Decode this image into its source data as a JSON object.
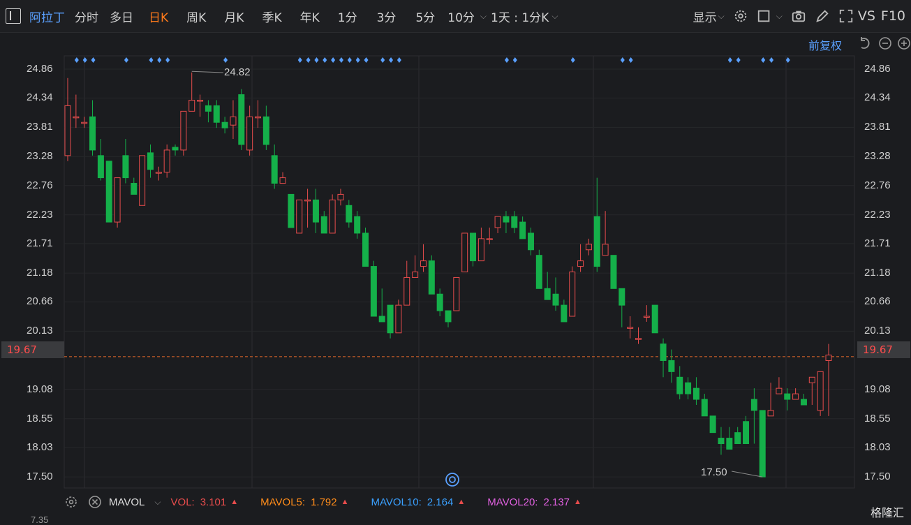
{
  "toolbar": {
    "stock_name": "阿拉丁",
    "periods": [
      "分时",
      "多日",
      "日K",
      "周K",
      "月K",
      "季K",
      "年K",
      "1分",
      "3分",
      "5分",
      "10分"
    ],
    "active_period": "日K",
    "interval_select": "1天 : 1分K",
    "display_label": "显示",
    "vs_label": "VS",
    "f10_label": "F10"
  },
  "chart": {
    "restore_label": "前复权",
    "price_ticks": [
      "24.86",
      "24.34",
      "23.81",
      "23.28",
      "22.76",
      "22.23",
      "21.71",
      "21.18",
      "20.66",
      "20.13",
      "19.08",
      "18.55",
      "18.03",
      "17.50"
    ],
    "current_price": "19.67",
    "high_label": "24.82",
    "low_label": "17.50",
    "bottom_partial": "7.35"
  },
  "indicators": {
    "name": "MAVOL",
    "vol_label": "VOL:",
    "vol_value": "3.101",
    "mavol5_label": "MAVOL5:",
    "mavol5_value": "1.792",
    "mavol10_label": "MAVOL10:",
    "mavol10_value": "2.164",
    "mavol20_label": "MAVOL20:",
    "mavol20_value": "2.137"
  },
  "colors": {
    "up": "#e74c4c",
    "down": "#15b04a",
    "accent": "#ff7a1a",
    "blue": "#5aa0ff",
    "mavol5": "#ff8c1a",
    "mavol10": "#3aa0ff",
    "mavol20": "#e060e0"
  },
  "watermark": "格隆汇",
  "chart_data": {
    "type": "candlestick",
    "ylim": [
      17.3,
      25.1
    ],
    "candles": [
      [
        23.3,
        24.2,
        24.7,
        23.2
      ],
      [
        24.0,
        24.0,
        24.4,
        23.8
      ],
      [
        23.9,
        23.9,
        24.0,
        23.8
      ],
      [
        24.0,
        23.4,
        24.3,
        23.3
      ],
      [
        23.3,
        22.9,
        23.6,
        22.85
      ],
      [
        23.2,
        22.1,
        23.2,
        22.1
      ],
      [
        22.1,
        22.9,
        22.9,
        22.0
      ],
      [
        23.3,
        22.9,
        23.6,
        22.8
      ],
      [
        22.8,
        22.6,
        22.9,
        22.6
      ],
      [
        22.4,
        23.3,
        23.3,
        22.4
      ],
      [
        23.35,
        23.05,
        23.5,
        22.9
      ],
      [
        23.0,
        23.0,
        23.1,
        22.85
      ],
      [
        23.0,
        23.4,
        23.5,
        22.9
      ],
      [
        23.45,
        23.4,
        23.5,
        23.3
      ],
      [
        23.4,
        24.1,
        24.1,
        23.3
      ],
      [
        24.1,
        24.3,
        24.8,
        24.1
      ],
      [
        24.3,
        24.3,
        24.4,
        24.0
      ],
      [
        24.2,
        24.1,
        24.3,
        23.9
      ],
      [
        24.2,
        23.9,
        24.3,
        23.8
      ],
      [
        23.9,
        23.8,
        24.0,
        23.7
      ],
      [
        23.85,
        24.0,
        24.3,
        23.6
      ],
      [
        24.4,
        23.5,
        24.5,
        23.4
      ],
      [
        23.4,
        24.0,
        24.2,
        23.3
      ],
      [
        24.0,
        24.0,
        24.3,
        23.8
      ],
      [
        24.0,
        23.5,
        24.2,
        23.4
      ],
      [
        23.3,
        22.8,
        23.5,
        22.7
      ],
      [
        22.8,
        22.9,
        23.0,
        22.8
      ],
      [
        22.6,
        22.0,
        22.6,
        22.0
      ],
      [
        21.9,
        22.5,
        22.5,
        21.9
      ],
      [
        22.5,
        22.5,
        22.7,
        22.0
      ],
      [
        22.5,
        22.1,
        22.7,
        21.9
      ],
      [
        22.2,
        21.9,
        22.3,
        21.9
      ],
      [
        21.9,
        22.5,
        22.6,
        21.9
      ],
      [
        22.5,
        22.6,
        22.7,
        22.4
      ],
      [
        22.4,
        22.1,
        22.5,
        22.0
      ],
      [
        22.2,
        21.9,
        22.3,
        21.8
      ],
      [
        21.9,
        21.3,
        22.0,
        21.3
      ],
      [
        21.3,
        20.4,
        21.4,
        20.4
      ],
      [
        20.4,
        20.3,
        20.9,
        20.3
      ],
      [
        20.6,
        20.1,
        20.6,
        20.0
      ],
      [
        20.1,
        20.6,
        20.7,
        20.1
      ],
      [
        20.6,
        21.1,
        21.4,
        20.6
      ],
      [
        21.1,
        21.2,
        21.5,
        21.1
      ],
      [
        21.3,
        21.4,
        21.7,
        21.2
      ],
      [
        21.4,
        20.8,
        21.5,
        20.8
      ],
      [
        20.8,
        20.5,
        20.9,
        20.4
      ],
      [
        20.5,
        20.3,
        20.5,
        20.2
      ],
      [
        20.5,
        21.1,
        21.1,
        20.5
      ],
      [
        21.2,
        21.9,
        21.9,
        21.2
      ],
      [
        21.9,
        21.4,
        21.9,
        21.3
      ],
      [
        21.4,
        21.8,
        22.0,
        21.4
      ],
      [
        21.8,
        21.8,
        22.0,
        21.7
      ],
      [
        22.0,
        22.2,
        22.2,
        21.9
      ],
      [
        22.2,
        22.1,
        22.3,
        21.9
      ],
      [
        22.2,
        22.0,
        22.3,
        21.9
      ],
      [
        22.1,
        21.8,
        22.2,
        21.8
      ],
      [
        21.9,
        21.6,
        22.0,
        21.5
      ],
      [
        21.5,
        20.9,
        21.6,
        20.9
      ],
      [
        20.9,
        20.7,
        21.2,
        20.7
      ],
      [
        20.8,
        20.6,
        21.1,
        20.5
      ],
      [
        20.6,
        20.3,
        20.7,
        20.3
      ],
      [
        20.4,
        21.2,
        21.3,
        20.4
      ],
      [
        21.3,
        21.4,
        21.7,
        21.2
      ],
      [
        21.6,
        21.7,
        21.8,
        21.5
      ],
      [
        22.2,
        21.3,
        22.9,
        21.2
      ],
      [
        21.5,
        21.7,
        22.3,
        21.5
      ],
      [
        21.5,
        20.9,
        21.5,
        20.9
      ],
      [
        20.9,
        20.6,
        20.9,
        20.2
      ],
      [
        20.2,
        20.2,
        20.4,
        20.0
      ],
      [
        20.0,
        20.0,
        20.2,
        19.9
      ],
      [
        20.4,
        20.4,
        20.6,
        20.3
      ],
      [
        20.6,
        20.1,
        20.6,
        20.1
      ],
      [
        19.9,
        19.6,
        20.0,
        19.3
      ],
      [
        19.6,
        19.4,
        19.8,
        19.2
      ],
      [
        19.3,
        19.0,
        19.5,
        18.9
      ],
      [
        19.2,
        19.0,
        19.3,
        18.9
      ],
      [
        19.1,
        18.9,
        19.3,
        18.8
      ],
      [
        18.9,
        18.6,
        19.0,
        18.6
      ],
      [
        18.6,
        18.3,
        18.6,
        18.3
      ],
      [
        18.2,
        18.1,
        18.4,
        17.9
      ],
      [
        18.2,
        18.0,
        18.4,
        18.0
      ],
      [
        18.3,
        18.1,
        18.4,
        18.1
      ],
      [
        18.5,
        18.1,
        18.6,
        18.1
      ],
      [
        18.9,
        18.7,
        19.1,
        18.1
      ],
      [
        18.7,
        17.5,
        18.7,
        17.5
      ],
      [
        18.6,
        18.7,
        19.2,
        18.6
      ],
      [
        19.0,
        19.1,
        19.3,
        19.0
      ],
      [
        19.0,
        18.9,
        19.1,
        18.7
      ],
      [
        18.9,
        19.0,
        19.1,
        18.9
      ],
      [
        18.9,
        18.8,
        19.0,
        18.8
      ],
      [
        19.2,
        19.3,
        19.3,
        18.8
      ],
      [
        18.7,
        19.4,
        19.4,
        18.6
      ],
      [
        19.6,
        19.7,
        19.9,
        18.6
      ]
    ],
    "dot_markers_columns": [
      1,
      2,
      3,
      7,
      10,
      11,
      12,
      19,
      28,
      29,
      30,
      31,
      32,
      33,
      34,
      35,
      36,
      38,
      39,
      40,
      53,
      54,
      61,
      67,
      68,
      80,
      81,
      84,
      85,
      87
    ]
  }
}
